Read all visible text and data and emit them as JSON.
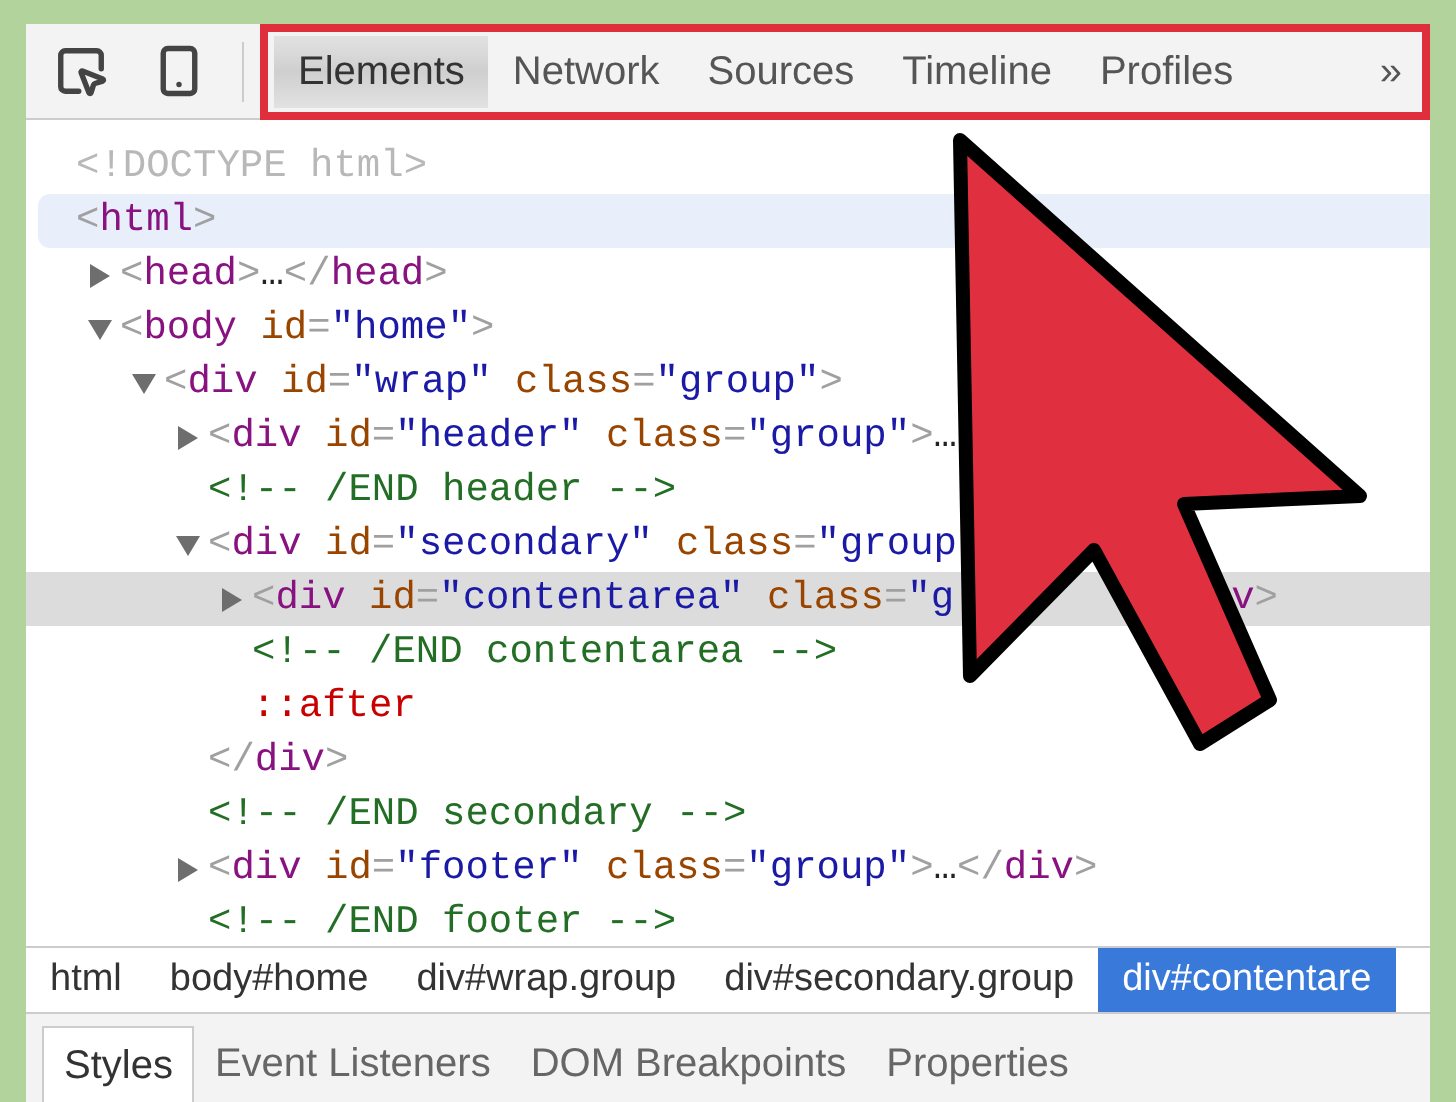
{
  "toolbar": {
    "tabs": [
      {
        "label": "Elements",
        "selected": true
      },
      {
        "label": "Network",
        "selected": false
      },
      {
        "label": "Sources",
        "selected": false
      },
      {
        "label": "Timeline",
        "selected": false
      },
      {
        "label": "Profiles",
        "selected": false
      }
    ],
    "more": "»"
  },
  "dom_tree": [
    {
      "selected": false,
      "hovered": false,
      "parts": [
        {
          "kind": "doctype",
          "text": "<!DOCTYPE html>"
        }
      ]
    },
    {
      "selected": false,
      "hovered": true,
      "parts": [
        {
          "kind": "punct",
          "text": "<"
        },
        {
          "kind": "tag",
          "text": "html"
        },
        {
          "kind": "punct",
          "text": ">"
        }
      ],
      "children": [
        {
          "selected": false,
          "hovered": false,
          "expanded": false,
          "parts": [
            {
              "kind": "punct",
              "text": "<"
            },
            {
              "kind": "tag",
              "text": "head"
            },
            {
              "kind": "punct",
              "text": ">"
            },
            {
              "kind": "text",
              "text": "…"
            },
            {
              "kind": "punct",
              "text": "</"
            },
            {
              "kind": "tag",
              "text": "head"
            },
            {
              "kind": "punct",
              "text": ">"
            }
          ]
        },
        {
          "selected": false,
          "hovered": false,
          "expanded": true,
          "parts": [
            {
              "kind": "punct",
              "text": "<"
            },
            {
              "kind": "tag",
              "text": "body"
            },
            {
              "kind": "attr",
              "text": " id"
            },
            {
              "kind": "punct",
              "text": "="
            },
            {
              "kind": "value",
              "text": "\"home\""
            },
            {
              "kind": "punct",
              "text": ">"
            }
          ],
          "children": [
            {
              "selected": false,
              "hovered": false,
              "expanded": true,
              "parts": [
                {
                  "kind": "punct",
                  "text": "<"
                },
                {
                  "kind": "tag",
                  "text": "div"
                },
                {
                  "kind": "attr",
                  "text": " id"
                },
                {
                  "kind": "punct",
                  "text": "="
                },
                {
                  "kind": "value",
                  "text": "\"wrap\""
                },
                {
                  "kind": "attr",
                  "text": " class"
                },
                {
                  "kind": "punct",
                  "text": "="
                },
                {
                  "kind": "value",
                  "text": "\"group\""
                },
                {
                  "kind": "punct",
                  "text": ">"
                }
              ],
              "children": [
                {
                  "selected": false,
                  "hovered": false,
                  "expanded": false,
                  "parts": [
                    {
                      "kind": "punct",
                      "text": "<"
                    },
                    {
                      "kind": "tag",
                      "text": "div"
                    },
                    {
                      "kind": "attr",
                      "text": " id"
                    },
                    {
                      "kind": "punct",
                      "text": "="
                    },
                    {
                      "kind": "value",
                      "text": "\"header\""
                    },
                    {
                      "kind": "attr",
                      "text": " class"
                    },
                    {
                      "kind": "punct",
                      "text": "="
                    },
                    {
                      "kind": "value",
                      "text": "\"group\""
                    },
                    {
                      "kind": "punct",
                      "text": ">"
                    },
                    {
                      "kind": "text",
                      "text": "…"
                    }
                  ]
                },
                {
                  "selected": false,
                  "hovered": false,
                  "parts": [
                    {
                      "kind": "comment",
                      "text": "<!-- /END header -->"
                    }
                  ]
                },
                {
                  "selected": false,
                  "hovered": false,
                  "expanded": true,
                  "parts": [
                    {
                      "kind": "punct",
                      "text": "<"
                    },
                    {
                      "kind": "tag",
                      "text": "div"
                    },
                    {
                      "kind": "attr",
                      "text": " id"
                    },
                    {
                      "kind": "punct",
                      "text": "="
                    },
                    {
                      "kind": "value",
                      "text": "\"secondary\""
                    },
                    {
                      "kind": "attr",
                      "text": " class"
                    },
                    {
                      "kind": "punct",
                      "text": "="
                    },
                    {
                      "kind": "value",
                      "text": "\"group"
                    }
                  ],
                  "children": [
                    {
                      "selected": true,
                      "hovered": false,
                      "expanded": false,
                      "parts": [
                        {
                          "kind": "punct",
                          "text": "<"
                        },
                        {
                          "kind": "tag",
                          "text": "div"
                        },
                        {
                          "kind": "attr",
                          "text": " id"
                        },
                        {
                          "kind": "punct",
                          "text": "="
                        },
                        {
                          "kind": "value",
                          "text": "\"contentarea\""
                        },
                        {
                          "kind": "attr",
                          "text": " class"
                        },
                        {
                          "kind": "punct",
                          "text": "="
                        },
                        {
                          "kind": "value",
                          "text": "\"g"
                        }
                      ],
                      "tail": [
                        {
                          "kind": "tag",
                          "text": "v"
                        },
                        {
                          "kind": "punct",
                          "text": ">"
                        }
                      ]
                    },
                    {
                      "selected": false,
                      "hovered": false,
                      "parts": [
                        {
                          "kind": "comment",
                          "text": "<!-- /END contentarea -->"
                        }
                      ]
                    },
                    {
                      "selected": false,
                      "hovered": false,
                      "parts": [
                        {
                          "kind": "pseudo",
                          "text": "::after"
                        }
                      ]
                    }
                  ]
                },
                {
                  "selected": false,
                  "hovered": false,
                  "parts": [
                    {
                      "kind": "punct",
                      "text": "</"
                    },
                    {
                      "kind": "tag",
                      "text": "div"
                    },
                    {
                      "kind": "punct",
                      "text": ">"
                    }
                  ]
                },
                {
                  "selected": false,
                  "hovered": false,
                  "parts": [
                    {
                      "kind": "comment",
                      "text": "<!-- /END secondary -->"
                    }
                  ]
                },
                {
                  "selected": false,
                  "hovered": false,
                  "expanded": false,
                  "parts": [
                    {
                      "kind": "punct",
                      "text": "<"
                    },
                    {
                      "kind": "tag",
                      "text": "div"
                    },
                    {
                      "kind": "attr",
                      "text": " id"
                    },
                    {
                      "kind": "punct",
                      "text": "="
                    },
                    {
                      "kind": "value",
                      "text": "\"footer\""
                    },
                    {
                      "kind": "attr",
                      "text": " class"
                    },
                    {
                      "kind": "punct",
                      "text": "="
                    },
                    {
                      "kind": "value",
                      "text": "\"group\""
                    },
                    {
                      "kind": "punct",
                      "text": ">"
                    },
                    {
                      "kind": "text",
                      "text": "…"
                    },
                    {
                      "kind": "punct",
                      "text": "</"
                    },
                    {
                      "kind": "tag",
                      "text": "div"
                    },
                    {
                      "kind": "punct",
                      "text": ">"
                    }
                  ]
                },
                {
                  "selected": false,
                  "hovered": false,
                  "parts": [
                    {
                      "kind": "comment",
                      "text": "<!-- /END footer -->"
                    }
                  ]
                }
              ]
            }
          ]
        }
      ]
    }
  ],
  "breadcrumbs": [
    {
      "label": "html",
      "selected": false
    },
    {
      "label": "body#home",
      "selected": false
    },
    {
      "label": "div#wrap.group",
      "selected": false
    },
    {
      "label": "div#secondary.group",
      "selected": false
    },
    {
      "label": "div#contentare",
      "selected": true
    }
  ],
  "side_tabs": [
    {
      "label": "Styles",
      "selected": true
    },
    {
      "label": "Event Listeners",
      "selected": false
    },
    {
      "label": "DOM Breakpoints",
      "selected": false
    },
    {
      "label": "Properties",
      "selected": false
    }
  ]
}
